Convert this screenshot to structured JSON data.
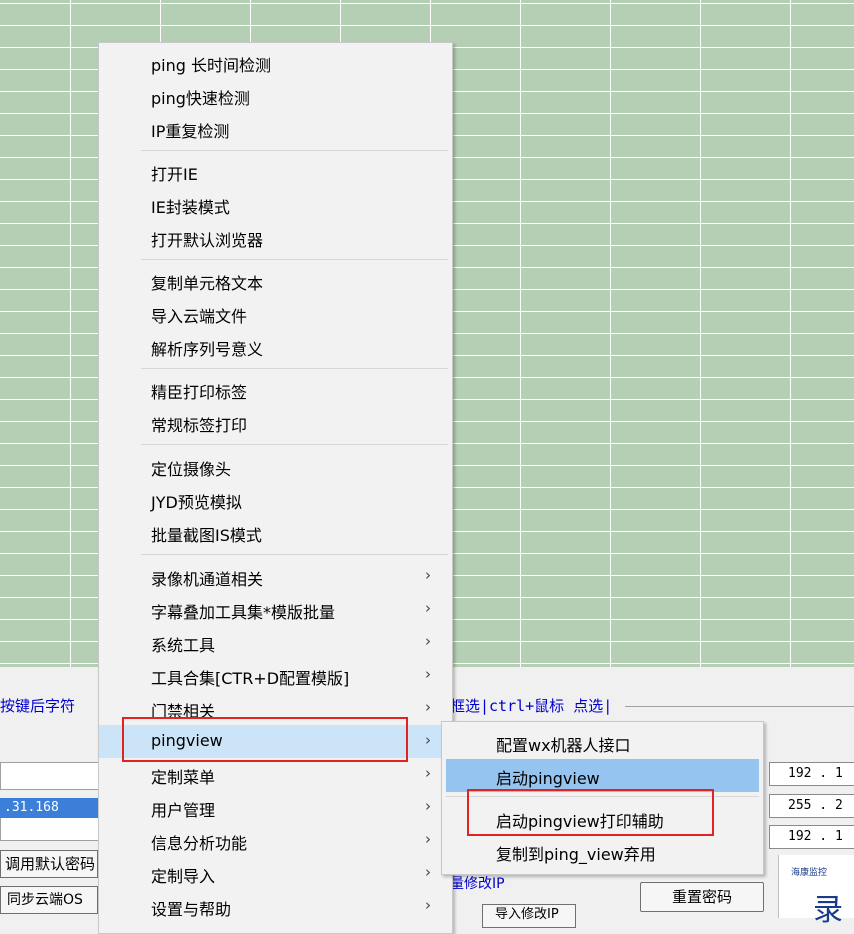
{
  "colors": {
    "grid_bg": "#b5cfb4",
    "highlight": "#cce4f7",
    "submenu_highlight": "#94c4ef",
    "annotation": "#e52222",
    "hint_text": "#0000cc"
  },
  "background": {
    "hint_left": "按键后字符",
    "hint_right": "框选|ctrl+鼠标 点选|",
    "selected_ip": ".31.168",
    "default_password_button": "调用默认密码",
    "sync_cloud_button": "同步云端OS",
    "modify_ip_label": "量修改IP",
    "import_modify_ip_button": "导入修改IP",
    "reset_password_button": "重置密码",
    "ip_fields": [
      "192 . 1",
      "255 . 2",
      "192 . 1"
    ],
    "logo_small": "海康监控",
    "logo_big": "录"
  },
  "menu": {
    "items": [
      {
        "label": "ping 长时间检测"
      },
      {
        "label": "ping快速检测"
      },
      {
        "label": "IP重复检测"
      },
      {
        "label": "打开IE"
      },
      {
        "label": "IE封装模式"
      },
      {
        "label": "打开默认浏览器"
      },
      {
        "label": "复制单元格文本"
      },
      {
        "label": "导入云端文件"
      },
      {
        "label": "解析序列号意义"
      },
      {
        "label": "精臣打印标签"
      },
      {
        "label": "常规标签打印"
      },
      {
        "label": "定位摄像头"
      },
      {
        "label": "JYD预览模拟"
      },
      {
        "label": "批量截图IS模式"
      },
      {
        "label": "录像机通道相关",
        "arrow": "›"
      },
      {
        "label": "字幕叠加工具集*模版批量",
        "arrow": "›"
      },
      {
        "label": "系统工具",
        "arrow": "›"
      },
      {
        "label": "工具合集[CTR+D配置模版]",
        "arrow": "›"
      },
      {
        "label": "门禁相关",
        "arrow": "›"
      },
      {
        "label": "pingview",
        "arrow": "›"
      },
      {
        "label": "定制菜单",
        "arrow": "›"
      },
      {
        "label": "用户管理",
        "arrow": "›"
      },
      {
        "label": "信息分析功能",
        "arrow": "›"
      },
      {
        "label": "定制导入",
        "arrow": "›"
      },
      {
        "label": "设置与帮助",
        "arrow": "›"
      }
    ]
  },
  "submenu": {
    "items": [
      {
        "label": "配置wx机器人接口"
      },
      {
        "label": "启动pingview"
      },
      {
        "label": "启动pingview打印辅助"
      },
      {
        "label": "复制到ping_view弃用"
      }
    ]
  }
}
